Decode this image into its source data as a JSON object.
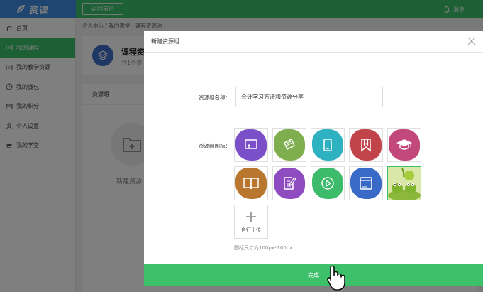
{
  "header": {
    "logo_text": "资课",
    "back_button": "返回前台",
    "messages_label": "消息"
  },
  "sidebar": {
    "items": [
      {
        "label": "首页",
        "icon": "home-icon"
      },
      {
        "label": "我的课程",
        "icon": "course-icon",
        "active": true
      },
      {
        "label": "我的教学资源",
        "icon": "resource-icon"
      },
      {
        "label": "我的钱包",
        "icon": "wallet-icon"
      },
      {
        "label": "我的积分",
        "icon": "points-icon"
      },
      {
        "label": "个人设置",
        "icon": "user-icon"
      },
      {
        "label": "我的学堂",
        "icon": "mortarboard-icon"
      }
    ]
  },
  "breadcrumb": "个人中心 / 我的课堂 - 课程资源池",
  "course": {
    "title": "课程资",
    "subtitle": "共1个资"
  },
  "group": {
    "header": "资源组",
    "new_label": "新建资源"
  },
  "modal": {
    "title": "新建资源组",
    "name_label": "资源组名称：",
    "name_value": "会计学习方法和资源分享",
    "icon_label": "资源组图标：",
    "icons": [
      {
        "name": "presentation-icon",
        "color": "#7b4fc8"
      },
      {
        "name": "certificate-icon",
        "color": "#7fae4e"
      },
      {
        "name": "tablet-icon",
        "color": "#2eb2c2"
      },
      {
        "name": "bookmark-icon",
        "color": "#c2444b"
      },
      {
        "name": "mortarboard-icon",
        "color": "#c2487c"
      },
      {
        "name": "book-icon",
        "color": "#b8762e"
      },
      {
        "name": "edit-note-icon",
        "color": "#8e4cc0"
      },
      {
        "name": "play-icon",
        "color": "#3cbb6b"
      },
      {
        "name": "window-list-icon",
        "color": "#3a6ac8"
      },
      {
        "name": "frog-photo-icon",
        "color": "#9cc93a"
      }
    ],
    "upload_label": "自行上传",
    "hint": "图标尺寸为100px*100px",
    "done_button": "完成"
  },
  "colors": {
    "accent": "#3cc06a",
    "logo_bg": "#3f8de0"
  }
}
